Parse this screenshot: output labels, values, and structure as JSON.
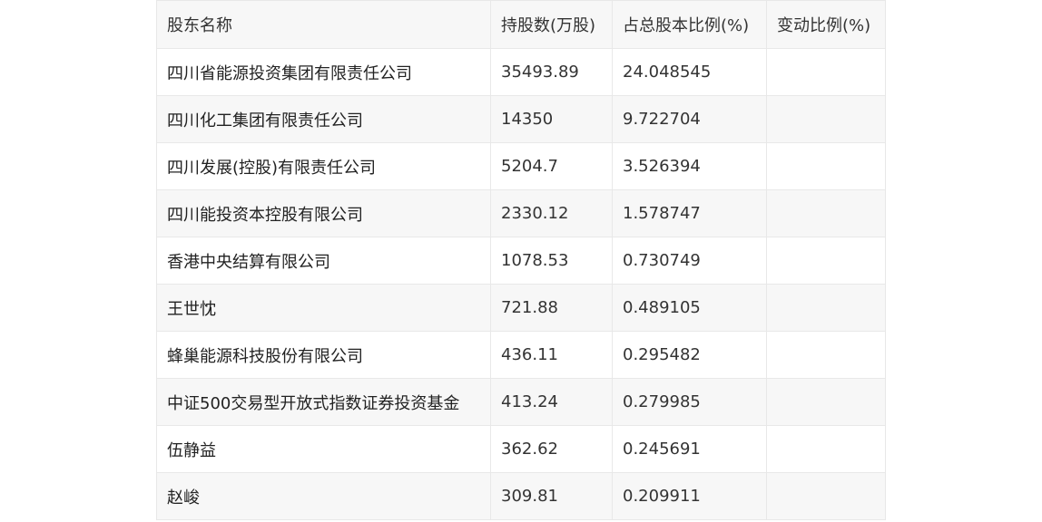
{
  "table": {
    "headers": [
      "股东名称",
      "持股数(万股)",
      "占总股本比例(%)",
      "变动比例(%)"
    ],
    "rows": [
      {
        "name": "四川省能源投资集团有限责任公司",
        "shares": "35493.89",
        "ratio": "24.048545",
        "change": ""
      },
      {
        "name": "四川化工集团有限责任公司",
        "shares": "14350",
        "ratio": "9.722704",
        "change": ""
      },
      {
        "name": "四川发展(控股)有限责任公司",
        "shares": "5204.7",
        "ratio": "3.526394",
        "change": ""
      },
      {
        "name": "四川能投资本控股有限公司",
        "shares": "2330.12",
        "ratio": "1.578747",
        "change": ""
      },
      {
        "name": "香港中央结算有限公司",
        "shares": "1078.53",
        "ratio": "0.730749",
        "change": ""
      },
      {
        "name": "王世忱",
        "shares": "721.88",
        "ratio": "0.489105",
        "change": ""
      },
      {
        "name": "蜂巢能源科技股份有限公司",
        "shares": "436.11",
        "ratio": "0.295482",
        "change": ""
      },
      {
        "name": "中证500交易型开放式指数证券投资基金",
        "shares": "413.24",
        "ratio": "0.279985",
        "change": ""
      },
      {
        "name": "伍静益",
        "shares": "362.62",
        "ratio": "0.245691",
        "change": ""
      },
      {
        "name": "赵峻",
        "shares": "309.81",
        "ratio": "0.209911",
        "change": ""
      }
    ]
  }
}
